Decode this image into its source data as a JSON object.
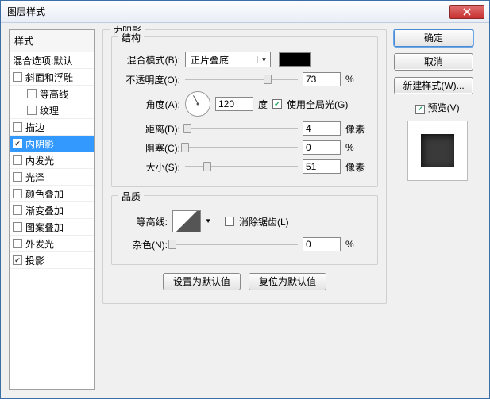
{
  "window": {
    "title": "图层样式"
  },
  "sidebar": {
    "header": "样式",
    "blendRow": "混合选项:默认",
    "items": [
      {
        "label": "斜面和浮雕",
        "checked": false,
        "indent": false
      },
      {
        "label": "等高线",
        "checked": false,
        "indent": true
      },
      {
        "label": "纹理",
        "checked": false,
        "indent": true
      },
      {
        "label": "描边",
        "checked": false,
        "indent": false
      },
      {
        "label": "内阴影",
        "checked": true,
        "indent": false,
        "selected": true
      },
      {
        "label": "内发光",
        "checked": false,
        "indent": false
      },
      {
        "label": "光泽",
        "checked": false,
        "indent": false
      },
      {
        "label": "颜色叠加",
        "checked": false,
        "indent": false
      },
      {
        "label": "渐变叠加",
        "checked": false,
        "indent": false
      },
      {
        "label": "图案叠加",
        "checked": false,
        "indent": false
      },
      {
        "label": "外发光",
        "checked": false,
        "indent": false
      },
      {
        "label": "投影",
        "checked": true,
        "indent": false
      }
    ]
  },
  "panel": {
    "title": "内阴影",
    "structure": {
      "legend": "结构",
      "blendMode": {
        "label": "混合模式(B):",
        "value": "正片叠底"
      },
      "opacity": {
        "label": "不透明度(O):",
        "value": "73",
        "unit": "%"
      },
      "angle": {
        "label": "角度(A):",
        "value": "120",
        "unit": "度",
        "globalLabel": "使用全局光(G)",
        "globalChecked": true
      },
      "distance": {
        "label": "距离(D):",
        "value": "4",
        "unit": "像素"
      },
      "choke": {
        "label": "阻塞(C):",
        "value": "0",
        "unit": "%"
      },
      "size": {
        "label": "大小(S):",
        "value": "51",
        "unit": "像素"
      }
    },
    "quality": {
      "legend": "品质",
      "contour": {
        "label": "等高线:",
        "antiAlias": "消除锯齿(L)",
        "antiAliasChecked": false
      },
      "noise": {
        "label": "杂色(N):",
        "value": "0",
        "unit": "%"
      }
    },
    "buttons": {
      "default": "设置为默认值",
      "reset": "复位为默认值"
    }
  },
  "right": {
    "ok": "确定",
    "cancel": "取消",
    "newStyle": "新建样式(W)...",
    "previewLabel": "预览(V)",
    "previewChecked": true
  }
}
